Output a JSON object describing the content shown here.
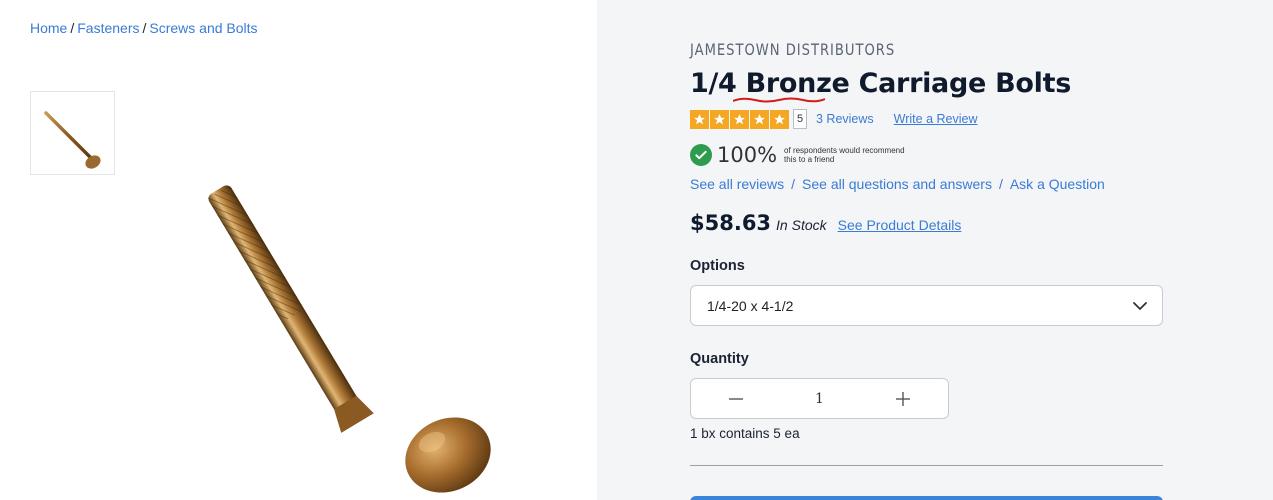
{
  "breadcrumb": {
    "items": [
      "Home",
      "Fasteners",
      "Screws and Bolts"
    ],
    "separator": "/"
  },
  "product": {
    "brand": "JAMESTOWN DISTRIBUTORS",
    "title": "1/4 Bronze Carriage Bolts",
    "rating": {
      "stars": 5,
      "value": "5",
      "reviews_label": "3 Reviews",
      "write_label": "Write a Review"
    },
    "recommend": {
      "percent": "100%",
      "text": "of respondents would recommend this to a friend"
    },
    "qa_links": [
      "See all reviews",
      "See all questions and answers",
      "Ask a Question"
    ],
    "price": "$58.63",
    "stock": "In Stock",
    "details_link": "See Product Details",
    "options_label": "Options",
    "selected_option": "1/4-20 x 4-1/2",
    "quantity_label": "Quantity",
    "quantity_value": "1",
    "box_note": "1 bx contains 5 ea"
  },
  "colors": {
    "link": "#3a7bd5",
    "star": "#f5a623",
    "check": "#2e9c4f",
    "panel_bg": "#f4f5f7",
    "button": "#3a84d9"
  },
  "icons": {
    "star": "star-icon",
    "check": "check-circle-icon",
    "chevron": "chevron-down-icon",
    "minus": "minus-icon",
    "plus": "plus-icon"
  }
}
